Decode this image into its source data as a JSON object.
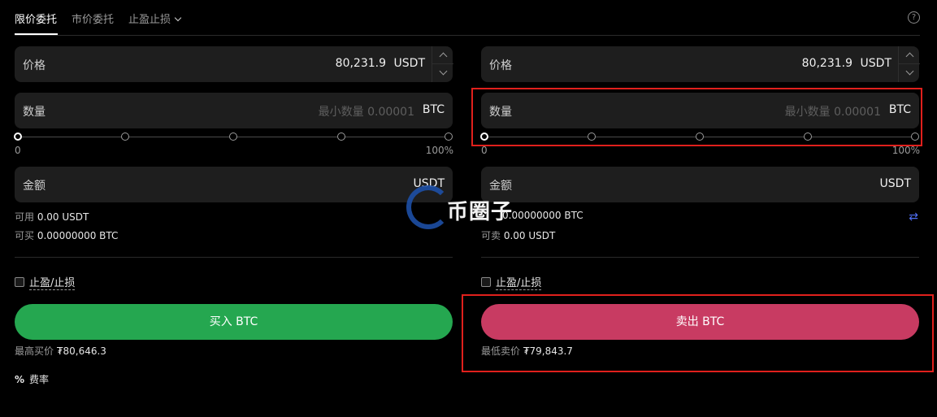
{
  "tabs": [
    {
      "label": "限价委托",
      "active": true
    },
    {
      "label": "市价委托",
      "active": false
    },
    {
      "label": "止盈止损",
      "active": false
    }
  ],
  "help_icon": "?",
  "buy": {
    "price_label": "价格",
    "price_value": "80,231.9",
    "price_unit": "USDT",
    "qty_label": "数量",
    "qty_placeholder": "最小数量 0.00001",
    "qty_unit": "BTC",
    "slider_min": "0",
    "slider_max": "100%",
    "slider_value": 0,
    "amount_label": "金额",
    "amount_unit": "USDT",
    "available_label": "可用",
    "available_value": "0.00 USDT",
    "max_label": "可买",
    "max_value": "0.00000000 BTC",
    "tpsl_label": "止盈/止损",
    "button_label": "买入 BTC",
    "best_label": "最高买价",
    "best_value": "₮80,646.3",
    "button_color": "#25a750"
  },
  "sell": {
    "price_label": "价格",
    "price_value": "80,231.9",
    "price_unit": "USDT",
    "qty_label": "数量",
    "qty_placeholder": "最小数量 0.00001",
    "qty_unit": "BTC",
    "slider_min": "0",
    "slider_max": "100%",
    "slider_value": 0,
    "amount_label": "金额",
    "amount_unit": "USDT",
    "available_value": "0.00000000 BTC",
    "max_label": "可卖",
    "max_value": "0.00 USDT",
    "tpsl_label": "止盈/止损",
    "button_label": "卖出 BTC",
    "best_label": "最低卖价",
    "best_value": "₮79,843.7",
    "button_color": "#c83b62"
  },
  "fee": {
    "icon": "%",
    "label": "费率"
  },
  "swap_icon": "⇄",
  "watermark": "币圈子",
  "highlight_color": "#e0201c"
}
